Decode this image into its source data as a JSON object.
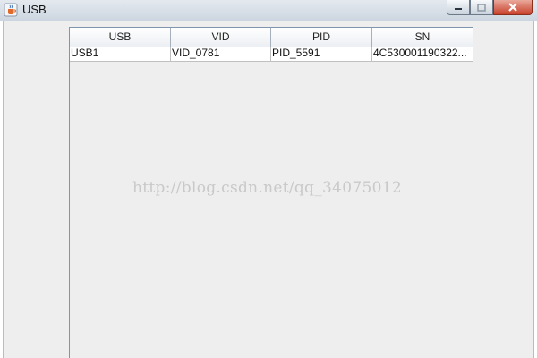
{
  "window": {
    "title": "USB"
  },
  "icons": {
    "app": "java-coffee-cup-icon",
    "minimize": "minimize-icon",
    "maximize": "maximize-icon",
    "close": "close-icon"
  },
  "colors": {
    "close_button": "#c8402b",
    "content_bg": "#eeeeee",
    "header_border": "#9aa6b4"
  },
  "table": {
    "columns": [
      "USB",
      "VID",
      "PID",
      "SN"
    ],
    "rows": [
      [
        "USB1",
        "VID_0781",
        "PID_5591",
        "4C530001190322..."
      ]
    ]
  },
  "watermark": "http://blog.csdn.net/qq_34075012"
}
